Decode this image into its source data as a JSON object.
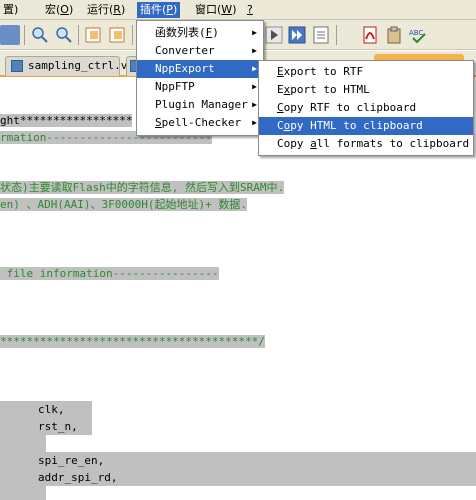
{
  "menubar": {
    "items": [
      {
        "label": "置)",
        "name": "menu-settings"
      },
      {
        "label": "宏(",
        "accel": "O",
        "tail": ")",
        "name": "menu-macro"
      },
      {
        "label": "运行(",
        "accel": "R",
        "tail": ")",
        "name": "menu-run"
      },
      {
        "label": "插件(",
        "accel": "P",
        "tail": ")",
        "name": "menu-plugins"
      },
      {
        "label": "窗口(",
        "accel": "W",
        "tail": ")",
        "name": "menu-window"
      },
      {
        "label": "",
        "accel": "?",
        "tail": "",
        "name": "menu-help"
      }
    ]
  },
  "tabs": [
    {
      "label": "sampling_ctrl.v"
    },
    {
      "label": ""
    }
  ],
  "plugins_menu": {
    "items": [
      {
        "label": "函数列表(",
        "accel": "F",
        "tail": ")",
        "submenu": true
      },
      {
        "label": "Converter",
        "accel": "",
        "tail": "",
        "submenu": true
      },
      {
        "label": "NppExport",
        "accel": "",
        "tail": "",
        "submenu": true
      },
      {
        "label": "NppFTP",
        "accel": "",
        "tail": "",
        "submenu": true
      },
      {
        "label": "Plugin Manager",
        "accel": "",
        "tail": "",
        "submenu": true
      },
      {
        "label": "",
        "accel": "S",
        "tail": "pell-Checker",
        "submenu": true
      }
    ],
    "selected_index": 2
  },
  "nppexport_menu": {
    "items": [
      {
        "pre": "",
        "accel": "E",
        "post": "xport to RTF"
      },
      {
        "pre": "E",
        "accel": "x",
        "post": "port to HTML"
      },
      {
        "pre": "",
        "accel": "C",
        "post": "opy RTF to clipboard"
      },
      {
        "pre": "C",
        "accel": "o",
        "post": "py HTML to clipboard"
      },
      {
        "pre": "Copy ",
        "accel": "a",
        "post": "ll formats to clipboard"
      }
    ],
    "selected_index": 3
  },
  "editor": {
    "lines": [
      "ght*****************",
      "rmation-------------------------",
      "状态)主要读取Flash中的字符信息, 然后写入到SRAM中.",
      "en) 、ADH(AAI)、3F0000H(起始地址)+ 数据.",
      " file information----------------",
      "***************************************/",
      "clk,",
      "rst_n,",
      "spi_re_en,",
      "addr_spi_rd,"
    ]
  },
  "colors": {
    "menu_highlight": "#316ac5",
    "comment_green": "#2d8a2d",
    "selection_gray": "#c0c0c0",
    "tab_accent": "#f0a040"
  }
}
